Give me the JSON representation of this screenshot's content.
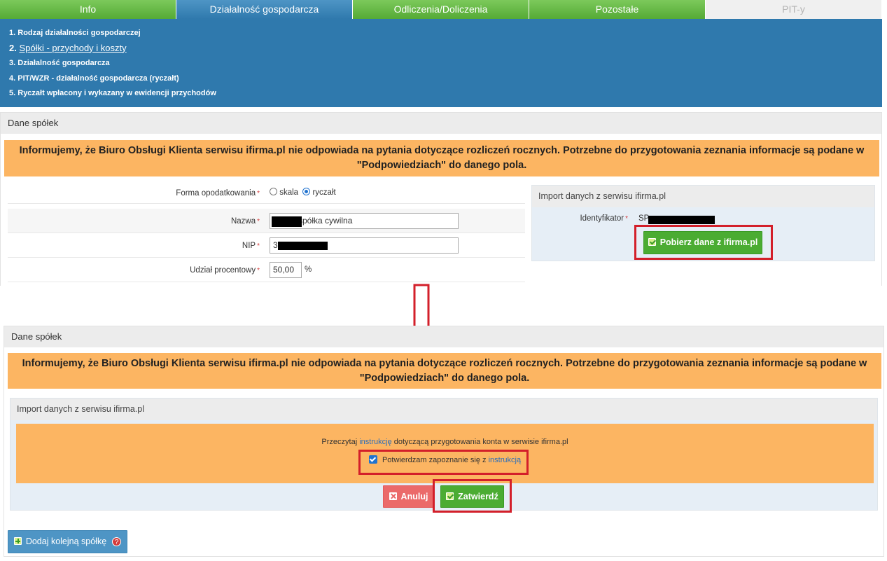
{
  "tabs": [
    {
      "label": "Info"
    },
    {
      "label": "Działalność gospodarcza"
    },
    {
      "label": "Odliczenia/Doliczenia"
    },
    {
      "label": "Pozostałe"
    },
    {
      "label": "PIT-y"
    }
  ],
  "steps": [
    {
      "num": "1.",
      "label": "Rodzaj działalności gospodarczej"
    },
    {
      "num": "2.",
      "label": "Spółki - przychody i koszty"
    },
    {
      "num": "3.",
      "label": "Działalność gospodarcza"
    },
    {
      "num": "4.",
      "label": "PIT/WZR - działalność gospodarcza (ryczałt)"
    },
    {
      "num": "5.",
      "label": "Ryczałt wpłacony i wykazany w ewidencji przychodów"
    }
  ],
  "panel_title": "Dane spółek",
  "info_message": "Informujemy, że Biuro Obsługi Klienta serwisu ifirma.pl nie odpowiada na pytania dotyczące rozliczeń rocznych. Potrzebne do przygotowania zeznania informacje są podane w \"Podpowiedziach\" do danego pola.",
  "form": {
    "tax_form_label": "Forma opodatkowania",
    "tax_options": [
      "skala",
      "ryczałt"
    ],
    "tax_selected": "ryczałt",
    "name_label": "Nazwa",
    "name_value": "spółka cywilna",
    "nip_label": "NIP",
    "nip_value": "3",
    "share_label": "Udział procentowy",
    "share_value": "50,00",
    "share_unit": "%",
    "required_mark": "*"
  },
  "import_box": {
    "title": "Import danych z serwisu ifirma.pl",
    "id_label": "Identyfikator",
    "id_value": "SP",
    "fetch_button": "Pobierz dane z ifirma.pl"
  },
  "import_dialog": {
    "title": "Import danych z serwisu ifirma.pl",
    "read_prefix": "Przeczytaj",
    "read_link": "instrukcję",
    "read_suffix": "dotyczącą przygotowania konta w serwisie ifirma.pl",
    "confirm_text": "Potwierdzam zapoznanie się z",
    "confirm_link": "instrukcją",
    "confirm_checked": true,
    "cancel_button": "Anuluj",
    "submit_button": "Zatwierdź"
  },
  "add_company_button": "Dodaj kolejną spółkę",
  "help_glyph": "?",
  "colors": {
    "tab_green": "#55aa35",
    "tab_active": "#2f79ad",
    "info_orange": "#fcb562",
    "highlight_red": "#d31f2a",
    "button_green": "#4bac32",
    "button_red": "#eb6a6a"
  }
}
